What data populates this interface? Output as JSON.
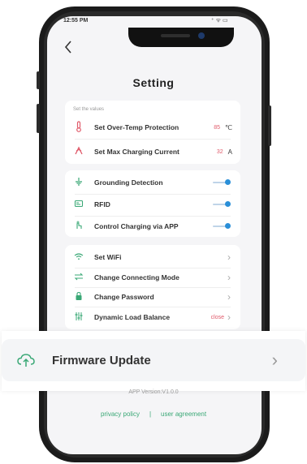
{
  "status": {
    "time": "12:55 PM",
    "icons": "⁺ ᯤ ▭"
  },
  "header": {
    "back_icon": "chevron-left-icon",
    "title": "Setting"
  },
  "values_card": {
    "hint": "Set the values",
    "items": [
      {
        "icon": "thermometer-icon",
        "label": "Set Over-Temp Protection",
        "value": "85",
        "unit": "℃"
      },
      {
        "icon": "gauge-icon",
        "label": "Set Max Charging Current",
        "value": "32",
        "unit": "A"
      }
    ]
  },
  "toggle_card": {
    "items": [
      {
        "icon": "grounding-icon",
        "label": "Grounding Detection",
        "on": true
      },
      {
        "icon": "rfid-icon",
        "label": "RFID",
        "on": true
      },
      {
        "icon": "hand-tap-icon",
        "label": "Control Charging via APP",
        "on": true
      }
    ]
  },
  "nav_card": {
    "items": [
      {
        "icon": "wifi-icon",
        "label": "Set WiFi"
      },
      {
        "icon": "swap-icon",
        "label": "Change Connecting Mode"
      },
      {
        "icon": "lock-icon",
        "label": "Change Password"
      },
      {
        "icon": "sliders-icon",
        "label": "Dynamic Load Balance",
        "status": "close"
      }
    ]
  },
  "firmware": {
    "icon": "cloud-upload-icon",
    "label": "Firmware Update"
  },
  "footer": {
    "app_version": "APP Version:V1.0.0",
    "privacy": "privacy policy",
    "separator": "|",
    "agreement": "user agreement"
  },
  "colors": {
    "accent": "#2a8fd8",
    "value_red": "#e05a6a",
    "link_green": "#3aa876"
  }
}
